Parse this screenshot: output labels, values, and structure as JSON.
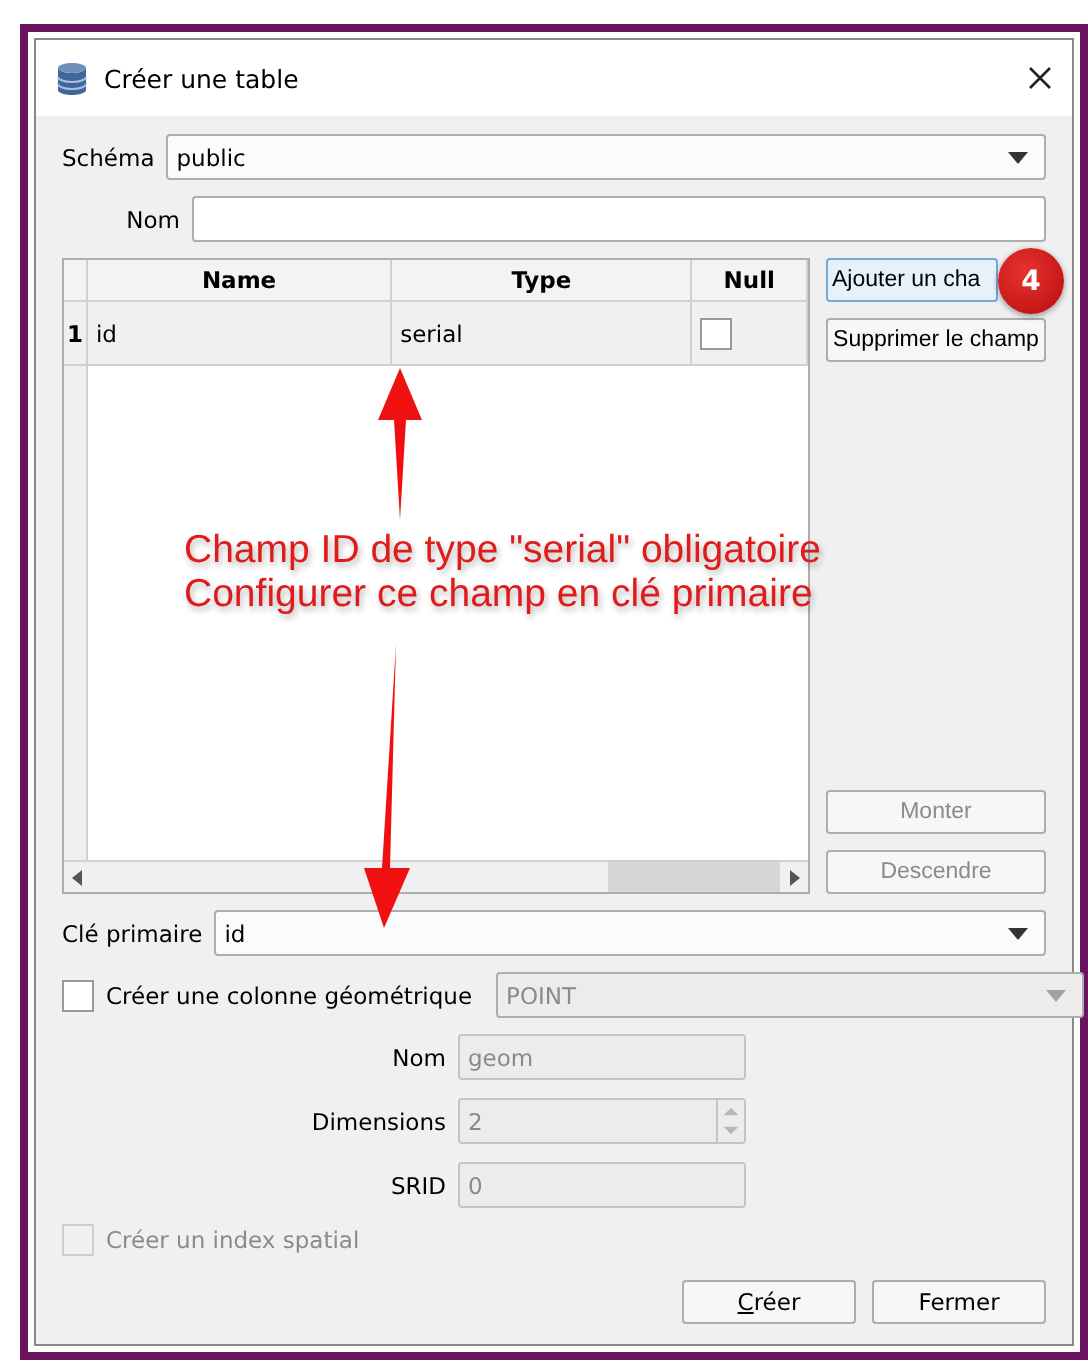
{
  "window": {
    "title": "Créer une table"
  },
  "schema": {
    "label": "Schéma",
    "value": "public"
  },
  "name": {
    "label": "Nom"
  },
  "fields_table": {
    "columns": [
      "Name",
      "Type",
      "Null"
    ],
    "rows": [
      {
        "number": "1",
        "name": "id",
        "type": "serial",
        "null": false
      }
    ]
  },
  "side_buttons": [
    {
      "label": "Ajouter un cha",
      "disabled": false
    },
    {
      "label": "Supprimer le champ",
      "disabled": false
    },
    {
      "label": "Monter",
      "disabled": true
    },
    {
      "label": "Descendre",
      "disabled": true
    }
  ],
  "badge": "4",
  "annotation": {
    "lines": [
      "Champ ID de type \"serial\" obligatoire",
      "Configurer ce champ en clé primaire"
    ]
  },
  "primary_key": {
    "label": "Clé primaire",
    "value": "id"
  },
  "geometry": {
    "label": "Créer une colonne géométrique",
    "checked": false,
    "type": "POINT",
    "fields": [
      {
        "kind": "text",
        "label": "Nom",
        "value": "geom"
      },
      {
        "kind": "spin",
        "label": "Dimensions",
        "value": "2"
      },
      {
        "kind": "text",
        "label": "SRID",
        "value": "0"
      }
    ]
  },
  "spatial_index": {
    "label": "Créer un index spatial",
    "checked": false,
    "disabled": true
  },
  "buttons": [
    {
      "label": "Créer",
      "mnemonic": true
    },
    {
      "label": "Fermer",
      "mnemonic": false
    }
  ]
}
